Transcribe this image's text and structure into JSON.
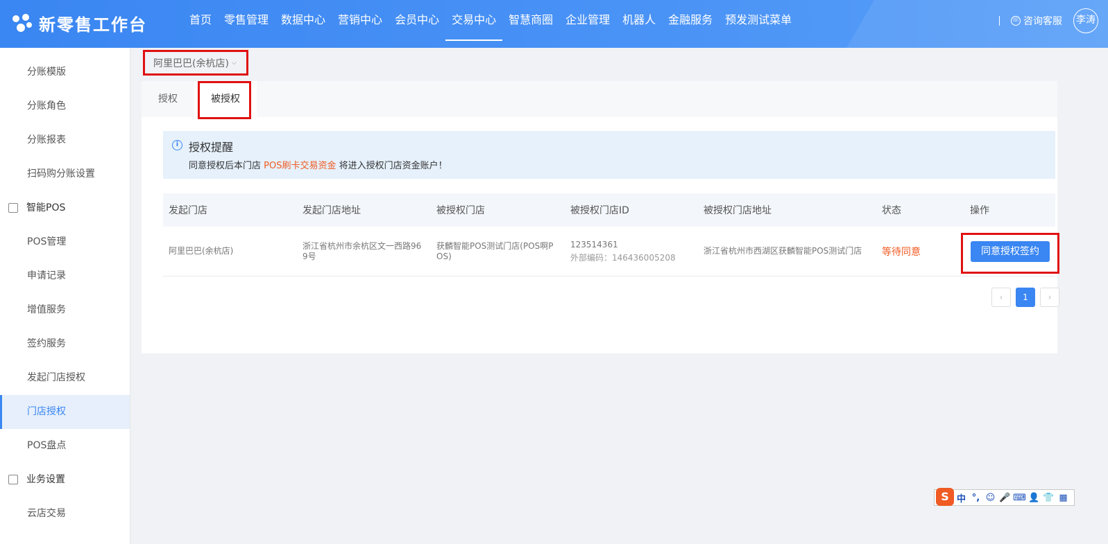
{
  "header": {
    "logo_text": "新零售工作台",
    "nav": [
      {
        "label": "首页"
      },
      {
        "label": "零售管理"
      },
      {
        "label": "数据中心"
      },
      {
        "label": "营销中心"
      },
      {
        "label": "会员中心"
      },
      {
        "label": "交易中心",
        "active": true
      },
      {
        "label": "智慧商圈"
      },
      {
        "label": "企业管理"
      },
      {
        "label": "机器人"
      },
      {
        "label": "金融服务"
      },
      {
        "label": "预发测试菜单"
      }
    ],
    "divider": "|",
    "service_label": "咨询客服",
    "avatar_text": "李涛"
  },
  "sidebar": {
    "items": [
      {
        "label": "分账模版"
      },
      {
        "label": "分账角色"
      },
      {
        "label": "分账报表"
      },
      {
        "label": "扫码购分账设置"
      },
      {
        "label": "智能POS",
        "group": true
      },
      {
        "label": "POS管理"
      },
      {
        "label": "申请记录"
      },
      {
        "label": "增值服务"
      },
      {
        "label": "签约服务"
      },
      {
        "label": "发起门店授权"
      },
      {
        "label": "门店授权",
        "active": true
      },
      {
        "label": "POS盘点"
      },
      {
        "label": "业务设置",
        "group": true
      },
      {
        "label": "云店交易"
      }
    ]
  },
  "store_select": {
    "value": "阿里巴巴(余杭店)",
    "chevron": "⌵"
  },
  "tabs": [
    {
      "label": "授权"
    },
    {
      "label": "被授权",
      "active": true
    }
  ],
  "notice": {
    "icon_glyph": "i",
    "title": "授权提醒",
    "body_pre": "同意授权后本门店 ",
    "body_highlight": "POS刷卡交易资金",
    "body_post": " 将进入授权门店资金账户！"
  },
  "table": {
    "headers": [
      "发起门店",
      "发起门店地址",
      "被授权门店",
      "被授权门店ID",
      "被授权门店地址",
      "状态",
      "操作"
    ],
    "rows": [
      {
        "origin_store": "阿里巴巴(余杭店)",
        "origin_address": "浙江省杭州市余杭区文一西路969号",
        "auth_store": "获麟智能POS测试门店(POS啊POS)",
        "auth_store_id": "123514361",
        "external_code": "外部编码：146436005208",
        "auth_address": "浙江省杭州市西湖区获麟智能POS测试门店",
        "status": "等待同意",
        "action": "同意授权签约"
      }
    ]
  },
  "pagination": {
    "prev": "‹",
    "current": "1",
    "next": "›"
  },
  "ime": {
    "items": [
      "中",
      "°,",
      "☺",
      "🎤",
      "⌨",
      "👤",
      "👕",
      "▦"
    ],
    "logo": "S"
  },
  "colors": {
    "primary": "#3a86f2",
    "highlight_border": "#e01010",
    "warning": "#f05a23"
  }
}
